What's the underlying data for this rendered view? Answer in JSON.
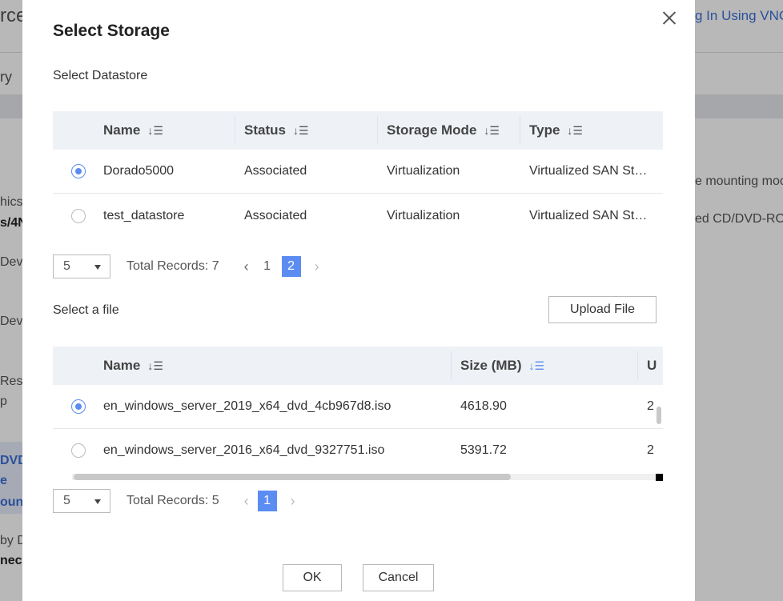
{
  "background": {
    "top_left_text": "rce",
    "top_right_link": "g In Using VNC",
    "tab_text": "ry",
    "mounting_text": "e mounting moc",
    "cdrom_text": "ed CD/DVD-RO",
    "left_texts": [
      "hics",
      "s/4N",
      "Dev",
      "Devi",
      "Res",
      "p",
      "DVD",
      "e",
      "oun",
      "by D",
      "nect"
    ]
  },
  "modal": {
    "title": "Select Storage",
    "datastore_section": {
      "label": "Select Datastore",
      "columns": [
        "Name",
        "Status",
        "Storage Mode",
        "Type"
      ],
      "rows": [
        {
          "selected": true,
          "name": "Dorado5000",
          "status": "Associated",
          "storage_mode": "Virtualization",
          "type": "Virtualized SAN Storage"
        },
        {
          "selected": false,
          "name": "test_datastore",
          "status": "Associated",
          "storage_mode": "Virtualization",
          "type": "Virtualized SAN Storage"
        }
      ],
      "pagination": {
        "page_size": "5",
        "total": "Total Records: 7",
        "pages": [
          "1",
          "2"
        ],
        "current_page": "2"
      }
    },
    "file_section": {
      "label": "Select a file",
      "upload_button": "Upload File",
      "columns": [
        "Name",
        "Size (MB)",
        "U"
      ],
      "rows": [
        {
          "selected": true,
          "name": "en_windows_server_2019_x64_dvd_4cb967d8.iso",
          "size": "4618.90",
          "extra": "2"
        },
        {
          "selected": false,
          "name": "en_windows_server_2016_x64_dvd_9327751.iso",
          "size": "5391.72",
          "extra": "2"
        }
      ],
      "pagination": {
        "page_size": "5",
        "total": "Total Records: 5",
        "pages": [
          "1"
        ],
        "current_page": "1"
      }
    },
    "ok_button": "OK",
    "cancel_button": "Cancel"
  },
  "colors": {
    "accent": "#5b8cf2",
    "header_bg": "#eef1f6",
    "link": "#3c6fd6"
  }
}
